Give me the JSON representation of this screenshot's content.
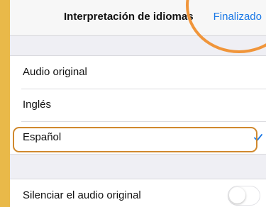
{
  "navbar": {
    "title": "Interpretación de idiomas",
    "done_label": "Finalizado"
  },
  "language_options": [
    {
      "label": "Audio original",
      "selected": false
    },
    {
      "label": "Inglés",
      "selected": false
    },
    {
      "label": "Español",
      "selected": true
    }
  ],
  "settings": {
    "mute_original_label": "Silenciar el audio original",
    "mute_original_on": false
  },
  "colors": {
    "accent": "#1a78e6",
    "highlight_annotation": "#d0892e",
    "circle_annotation": "#f0953a",
    "background": "#e9b949"
  }
}
